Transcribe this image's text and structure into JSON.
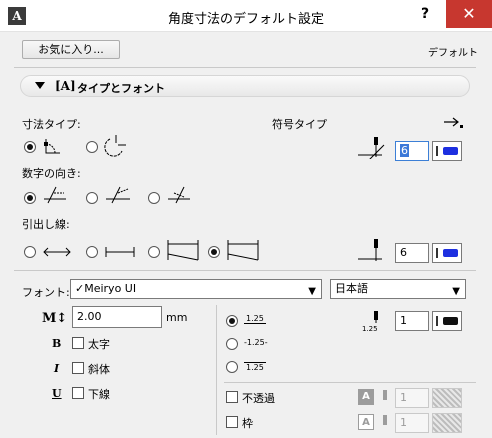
{
  "window": {
    "title": "角度寸法のデフォルト設定",
    "help_label": "?",
    "close_label": "✕"
  },
  "header": {
    "favorites_label": "お気に入り...",
    "default_label": "デフォルト"
  },
  "section": {
    "title": "タイプとフォント"
  },
  "dim_type": {
    "label": "寸法タイプ:",
    "marker_label": "符号タイプ",
    "marker_size": "6"
  },
  "text_orient": {
    "label": "数字の向き:"
  },
  "witness": {
    "label": "引出し線:",
    "size": "6"
  },
  "font": {
    "label": "フォント:",
    "value": "✓Meiryo UI",
    "script": "日本語",
    "size_value": "2.00",
    "unit": "mm"
  },
  "styles": {
    "bold": "太字",
    "italic": "斜体",
    "underline": "下線"
  },
  "numbers": {
    "opt1": "1.25",
    "opt2": "-1.25-",
    "opt3": "1.25",
    "pen_number": "1"
  },
  "opaque": {
    "label": "不透過",
    "value": "1"
  },
  "frame_opt": {
    "label": "枠",
    "value": "1"
  },
  "colors": {
    "pen_blue": "#1d2fe0",
    "pen_black": "#111111"
  }
}
